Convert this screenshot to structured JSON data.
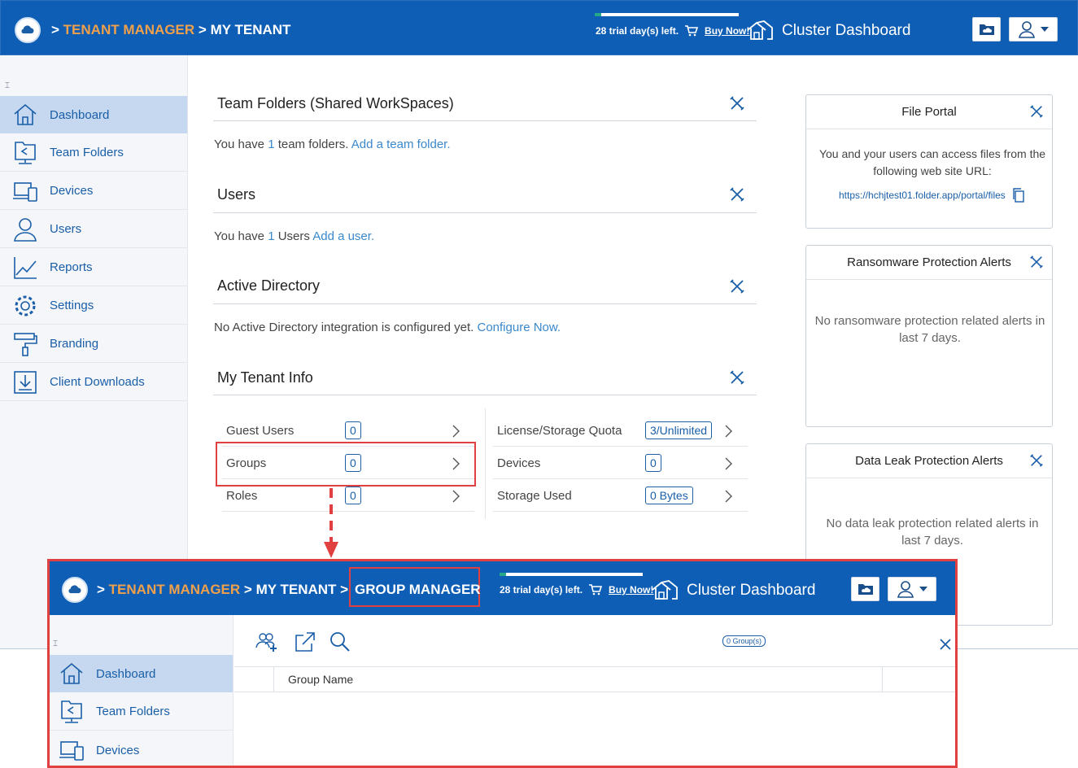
{
  "header": {
    "crumb_sep": ">",
    "tenant_manager": "TENANT MANAGER",
    "my_tenant": "MY TENANT",
    "trial_text": "28 trial day(s) left.",
    "buy_now": "Buy Now!",
    "cluster_dashboard": "Cluster Dashboard"
  },
  "sidebar": {
    "items": [
      {
        "label": "Dashboard",
        "icon": "home-icon"
      },
      {
        "label": "Team Folders",
        "icon": "team-folder-icon"
      },
      {
        "label": "Devices",
        "icon": "devices-icon"
      },
      {
        "label": "Users",
        "icon": "users-icon"
      },
      {
        "label": "Reports",
        "icon": "reports-icon"
      },
      {
        "label": "Settings",
        "icon": "settings-icon"
      },
      {
        "label": "Branding",
        "icon": "branding-icon"
      },
      {
        "label": "Client Downloads",
        "icon": "download-icon"
      }
    ]
  },
  "main": {
    "team_folders": {
      "title": "Team Folders (Shared WorkSpaces)",
      "text_pre": "You have",
      "count": "1",
      "text_post": "team folders.",
      "link": "Add a team folder."
    },
    "users": {
      "title": "Users",
      "text_pre": "You have",
      "count": "1",
      "text_post": "Users",
      "link": "Add a user."
    },
    "active_directory": {
      "title": "Active Directory",
      "text": "No Active Directory integration is configured yet.",
      "link": "Configure Now."
    },
    "tenant_info": {
      "title": "My Tenant Info",
      "left": [
        {
          "label": "Guest Users",
          "value": "0"
        },
        {
          "label": "Groups",
          "value": "0"
        },
        {
          "label": "Roles",
          "value": "0"
        }
      ],
      "right": [
        {
          "label": "License/Storage Quota",
          "value": "3/Unlimited"
        },
        {
          "label": "Devices",
          "value": "0"
        },
        {
          "label": "Storage Used",
          "value": "0 Bytes"
        }
      ]
    }
  },
  "panels": {
    "file_portal": {
      "title": "File Portal",
      "text": "You and your users can access files from the following web site URL:",
      "url": "https://hchjtest01.folder.app/portal/files"
    },
    "ransomware": {
      "title": "Ransomware Protection Alerts",
      "text": "No ransomware protection related alerts in last 7 days."
    },
    "data_leak": {
      "title": "Data Leak Protection Alerts",
      "text": "No data leak protection related alerts in last 7 days."
    }
  },
  "inset": {
    "group_manager": "GROUP MANAGER",
    "group_count": "0 Group(s)",
    "column_group_name": "Group Name",
    "sidebar_items": [
      "Dashboard",
      "Team Folders",
      "Devices"
    ]
  }
}
